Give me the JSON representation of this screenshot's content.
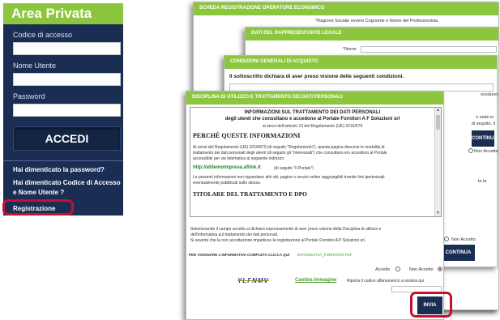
{
  "login": {
    "title": "Area Privata",
    "access_code_label": "Codice di accesso",
    "username_label": "Nome Utente",
    "password_label": "Password",
    "submit_label": "ACCEDI",
    "forgot_password": "Hai dimenticato la password?",
    "forgot_code": "Hai dimenticato Codice di Accesso e Nome Utente ?",
    "register": "Registrazione"
  },
  "win1": {
    "title": "SCHEDA REGISTRAZIONE OPERATORE ECONOMICO",
    "note": "*Ragione Sociale ovvero Cognome e Nome del Professionista"
  },
  "win2": {
    "title": "DATI DEL RAPPRESENTANTE LEGALE",
    "name_label": "*Nome",
    "fragment_sede": "n sede in",
    "fragment_seguito": "di seguito, il",
    "fragment_cedure": "ocedure)",
    "button_label": "CONTINUA"
  },
  "win3": {
    "title": "CONDIZIONI GENERALI DI ACQUISTO",
    "intro": "Il sottoscritto dichiara di aver preso visione delle seguenti condizioni.",
    "not_accept_label": "Non Accetto",
    "fragment_le": "te le",
    "button_label": "CONTINUA"
  },
  "win4": {
    "title": "DISCIPLINA DI UTILIZZO E TRATTAMENTO DEI DATI PERSONALI",
    "doc": {
      "heading": "INFORMAZIONI SUL TRATTAMENTO DEI DATI PERSONALI",
      "subheading": "degli utenti che consultano e accedono al Portale Fornitori A F Soluzioni srl",
      "reg_ref": "ai sensi dell'articolo 13 del Regolamento (UE) 2016/679",
      "section1": "PERCHÉ QUESTE INFORMAZIONI",
      "para1_l1": "Ai sensi del Regolamento (UE) 2016/679 (di seguito \"Regolamento\"), questa pagina descrive le modalità di",
      "para1_l2": "trattamento dei dati personali degli utenti (di seguito gli \"Interessati\") che consultano e/o accedono al Portale",
      "para1_l3": "accessibile per via telematica al seguente indirizzo:",
      "url": "http://afdemoimpresa.aflink.it",
      "url_suffix": "(di seguito \"il Portale\")",
      "para2_l1": "Le presenti informazioni non riguardano altri siti, pagine o servizi online raggiungibili tramite link ipertestuali",
      "para2_l2": "eventualmente pubblicati sullo stesso.",
      "section2": "TITOLARE DEL TRATTAMENTO E DPO"
    },
    "notice_l1": "Selezionando il campo accetta si dichiara espressamente di aver preso visione della Disciplina di utilizzo e",
    "notice_l2": "dell'informativa sul trattamento dei dati personali.",
    "notice_l3": "Si avverte che la non accettazione impedisce la registrazione al Portale Fornitori A P Soluzioni srl.",
    "full_info_label": "PER VISIONARE L'INFORMATIVA COMPLETA CLICCA QUI",
    "full_info_link": "INFORMATIVA_FORNITORI.PDF",
    "accept_label": "Accetto",
    "not_accept_label": "Non Accetto",
    "captcha_text": "YLFNMV",
    "change_image": "Cambia Immagine",
    "captcha_prompt": "Riporta il codice alfanumerico a sinistra qui",
    "submit_label": "INVIA"
  },
  "colors": {
    "green": "#8cc63f",
    "navy": "#1a2d52",
    "highlight_red": "#c8102e"
  }
}
